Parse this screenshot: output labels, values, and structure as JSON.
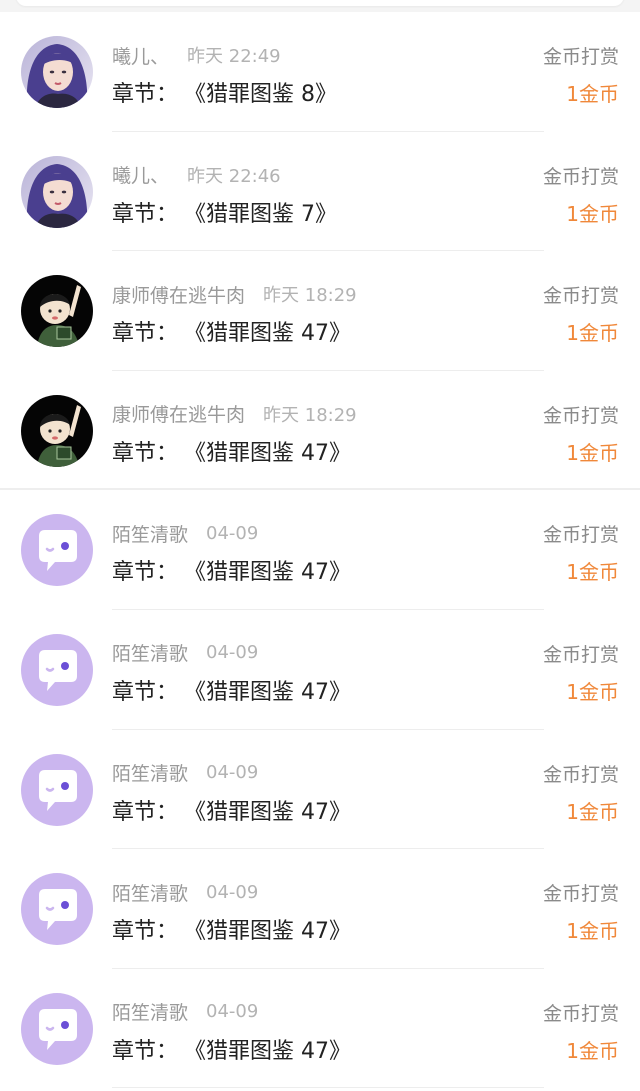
{
  "rewards": [
    {
      "username": "曦儿、",
      "time": "昨天 22:49",
      "chapter_label": "章节：",
      "chapter_title": "《猎罪图鉴 8》",
      "reward_type": "金币打赏",
      "amount": "1金币",
      "avatar": "girl-photo-avatar"
    },
    {
      "username": "曦儿、",
      "time": "昨天 22:46",
      "chapter_label": "章节：",
      "chapter_title": "《猎罪图鉴 7》",
      "reward_type": "金币打赏",
      "amount": "1金币",
      "avatar": "girl-photo-avatar"
    },
    {
      "username": "康师傅在逃牛肉",
      "time": "昨天 18:29",
      "chapter_label": "章节：",
      "chapter_title": "《猎罪图鉴 47》",
      "reward_type": "金币打赏",
      "amount": "1金币",
      "avatar": "cartoon-boy-avatar"
    },
    {
      "username": "康师傅在逃牛肉",
      "time": "昨天 18:29",
      "chapter_label": "章节：",
      "chapter_title": "《猎罪图鉴 47》",
      "reward_type": "金币打赏",
      "amount": "1金币",
      "avatar": "cartoon-boy-avatar"
    },
    {
      "username": "陌笙清歌",
      "time": "04-09",
      "chapter_label": "章节：",
      "chapter_title": "《猎罪图鉴 47》",
      "reward_type": "金币打赏",
      "amount": "1金币",
      "avatar": "default-chat-avatar"
    },
    {
      "username": "陌笙清歌",
      "time": "04-09",
      "chapter_label": "章节：",
      "chapter_title": "《猎罪图鉴 47》",
      "reward_type": "金币打赏",
      "amount": "1金币",
      "avatar": "default-chat-avatar"
    },
    {
      "username": "陌笙清歌",
      "time": "04-09",
      "chapter_label": "章节：",
      "chapter_title": "《猎罪图鉴 47》",
      "reward_type": "金币打赏",
      "amount": "1金币",
      "avatar": "default-chat-avatar"
    },
    {
      "username": "陌笙清歌",
      "time": "04-09",
      "chapter_label": "章节：",
      "chapter_title": "《猎罪图鉴 47》",
      "reward_type": "金币打赏",
      "amount": "1金币",
      "avatar": "default-chat-avatar"
    },
    {
      "username": "陌笙清歌",
      "time": "04-09",
      "chapter_label": "章节：",
      "chapter_title": "《猎罪图鉴 47》",
      "reward_type": "金币打赏",
      "amount": "1金币",
      "avatar": "default-chat-avatar"
    }
  ],
  "colors": {
    "amount": "#f0883a",
    "default_avatar_bg": "#cbb6ef",
    "girl_hair": "#4a3f8f"
  }
}
